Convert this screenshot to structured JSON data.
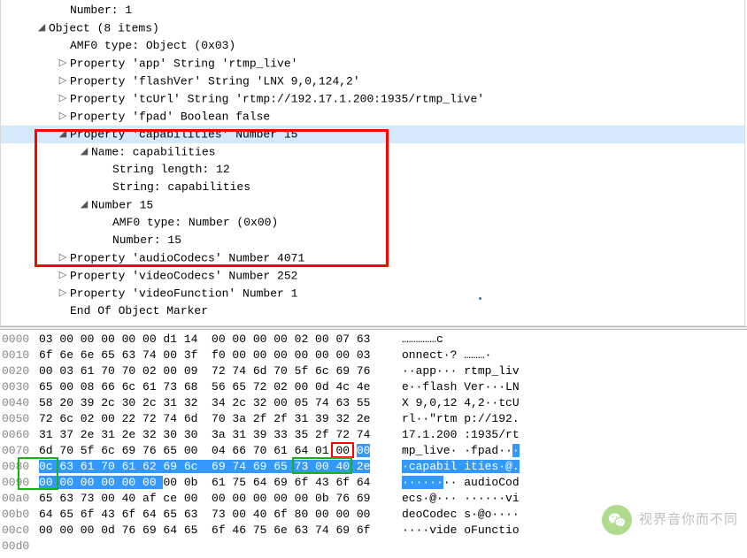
{
  "tree": {
    "rows": [
      {
        "indent": 5,
        "tw": "",
        "text": "Number: 1"
      },
      {
        "indent": 3,
        "tw": "▿",
        "text": "Object (8 items)"
      },
      {
        "indent": 5,
        "tw": "",
        "text": "AMF0 type: Object (0x03)"
      },
      {
        "indent": 5,
        "tw": "▹",
        "text": "Property 'app' String 'rtmp_live'"
      },
      {
        "indent": 5,
        "tw": "▹",
        "text": "Property 'flashVer' String 'LNX 9,0,124,2'"
      },
      {
        "indent": 5,
        "tw": "▹",
        "text": "Property 'tcUrl' String 'rtmp://192.17.1.200:1935/rtmp_live'"
      },
      {
        "indent": 5,
        "tw": "▹",
        "text": "Property 'fpad' Boolean false"
      },
      {
        "indent": 5,
        "tw": "▿",
        "text": "Property 'capabilities' Number 15",
        "hl": true
      },
      {
        "indent": 7,
        "tw": "▿",
        "text": "Name: capabilities"
      },
      {
        "indent": 9,
        "tw": "",
        "text": "String length: 12"
      },
      {
        "indent": 9,
        "tw": "",
        "text": "String: capabilities"
      },
      {
        "indent": 7,
        "tw": "▿",
        "text": "Number 15"
      },
      {
        "indent": 9,
        "tw": "",
        "text": "AMF0 type: Number (0x00)"
      },
      {
        "indent": 9,
        "tw": "",
        "text": "Number: 15"
      },
      {
        "indent": 5,
        "tw": "▹",
        "text": "Property 'audioCodecs' Number 4071"
      },
      {
        "indent": 5,
        "tw": "▹",
        "text": "Property 'videoCodecs' Number 252"
      },
      {
        "indent": 5,
        "tw": "▹",
        "text": "Property 'videoFunction' Number 1"
      },
      {
        "indent": 5,
        "tw": "",
        "text": "End Of Object Marker"
      }
    ]
  },
  "hex": {
    "rows": [
      {
        "off": "0000",
        "b": "03 00 00 00 00 00 d1 14  00 00 00 00 02 00 07 63",
        "a": "……………c"
      },
      {
        "off": "0010",
        "b": "6f 6e 6e 65 63 74 00 3f  f0 00 00 00 00 00 00 03",
        "a": "onnect·? ………·"
      },
      {
        "off": "0020",
        "b": "00 03 61 70 70 02 00 09  72 74 6d 70 5f 6c 69 76",
        "a": "··app··· rtmp_liv"
      },
      {
        "off": "0030",
        "b": "65 00 08 66 6c 61 73 68  56 65 72 02 00 0d 4c 4e",
        "a": "e··flash Ver···LN"
      },
      {
        "off": "0040",
        "b": "58 20 39 2c 30 2c 31 32  34 2c 32 00 05 74 63 55",
        "a": "X 9,0,12 4,2··tcU"
      },
      {
        "off": "0050",
        "b": "72 6c 02 00 22 72 74 6d  70 3a 2f 2f 31 39 32 2e",
        "a": "rl··\"rtm p://192."
      },
      {
        "off": "0060",
        "b": "31 37 2e 31 2e 32 30 30  3a 31 39 33 35 2f 72 74",
        "a": "17.1.200 :1935/rt"
      },
      {
        "off": "0070",
        "b1": "6d 70 5f 6c 69 76 65 00  04 66 70 61 64 01 00 ",
        "b2": "00",
        "a1": "mp_live· ·fpad··",
        "a2": "·"
      },
      {
        "off": "0080",
        "b1": "0c ",
        "b2": "63 61 70 61 62 69 6c  69 74 69 65 73 ",
        "b3": "00 ",
        "b4": "40 2e",
        "a1": "·",
        "a2": "capabil ities",
        "a3": "·@."
      },
      {
        "off": "0090",
        "b1": "00 00 00 00 00 00 ",
        "b2": "00 0b  61 75 64 69 6f 43 6f 64",
        "a1": "······",
        "a2": "·· audioCod"
      },
      {
        "off": "00a0",
        "b": "65 63 73 00 40 af ce 00  00 00 00 00 00 0b 76 69",
        "a": "ecs·@··· ······vi"
      },
      {
        "off": "00b0",
        "b": "64 65 6f 43 6f 64 65 63  73 00 40 6f 80 00 00 00",
        "a": "deoCodec s·@o····"
      },
      {
        "off": "00c0",
        "b": "00 00 00 0d 76 69 64 65  6f 46 75 6e 63 74 69 6f",
        "a": "····vide oFunctio"
      },
      {
        "off": "00d0",
        "b": "",
        "a": ""
      }
    ]
  },
  "watermark": "视界音你而不同"
}
